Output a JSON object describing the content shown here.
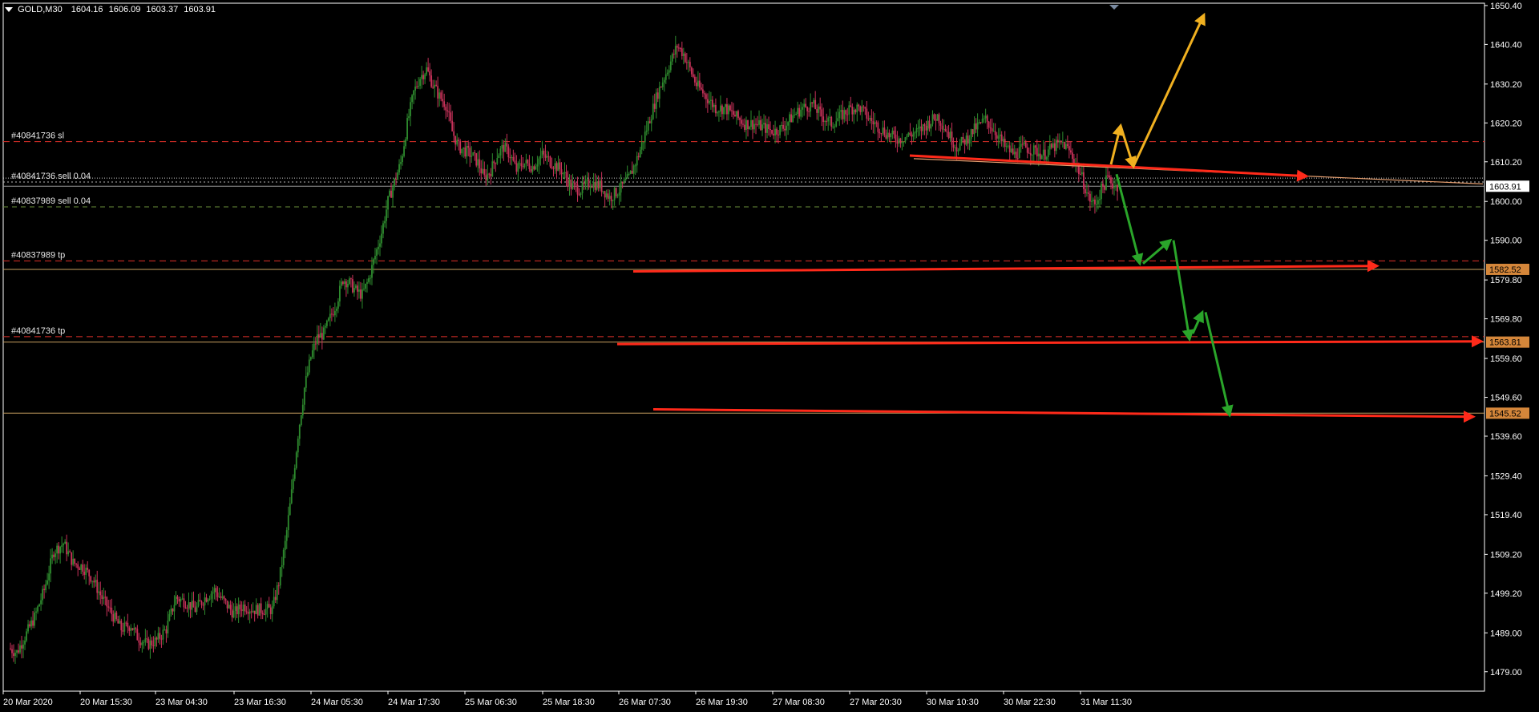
{
  "header": {
    "symbol": "GOLD,M30",
    "open": "1604.16",
    "high": "1606.09",
    "low": "1603.37",
    "close": "1603.91"
  },
  "colors": {
    "background": "#000000",
    "bull": "#2e8b2e",
    "bear": "#c8325a",
    "axis": "#ffffff",
    "sl_line": "#e0302a",
    "sell_line": "#6a8f3a",
    "tp_line": "#e0302a",
    "level_line": "#c8a060",
    "arrow_red": "#ff2a1a",
    "arrow_green": "#2aa52a",
    "arrow_yellow": "#f0b020",
    "bid_label": "#ffffff",
    "level_label": "#d4863a"
  },
  "chart_data": {
    "type": "candlestick",
    "symbol": "GOLD",
    "timeframe": "M30",
    "ylim": [
      1474.0,
      1651.0
    ],
    "y_ticks": [
      "1650.40",
      "1640.40",
      "1630.20",
      "1620.20",
      "1610.20",
      "1600.00",
      "1590.00",
      "1579.80",
      "1569.80",
      "1559.60",
      "1549.60",
      "1539.60",
      "1529.40",
      "1519.40",
      "1509.20",
      "1499.20",
      "1489.00",
      "1479.00"
    ],
    "x_labels": [
      "20 Mar 2020",
      "20 Mar 15:30",
      "23 Mar 04:30",
      "23 Mar 16:30",
      "24 Mar 05:30",
      "24 Mar 17:30",
      "25 Mar 06:30",
      "25 Mar 18:30",
      "26 Mar 07:30",
      "26 Mar 19:30",
      "27 Mar 08:30",
      "27 Mar 20:30",
      "30 Mar 10:30",
      "30 Mar 22:30",
      "31 Mar 11:30"
    ],
    "price_anchors": [
      [
        0,
        1485
      ],
      [
        5,
        1484
      ],
      [
        10,
        1488
      ],
      [
        16,
        1493
      ],
      [
        22,
        1500
      ],
      [
        28,
        1510
      ],
      [
        34,
        1512
      ],
      [
        40,
        1507
      ],
      [
        46,
        1506
      ],
      [
        52,
        1503
      ],
      [
        58,
        1498
      ],
      [
        64,
        1494
      ],
      [
        70,
        1490
      ],
      [
        76,
        1491
      ],
      [
        80,
        1488
      ],
      [
        86,
        1486
      ],
      [
        92,
        1487
      ],
      [
        98,
        1490
      ],
      [
        104,
        1498
      ],
      [
        110,
        1497
      ],
      [
        116,
        1495
      ],
      [
        122,
        1498
      ],
      [
        128,
        1500
      ],
      [
        134,
        1497
      ],
      [
        140,
        1494
      ],
      [
        146,
        1496
      ],
      [
        152,
        1495
      ],
      [
        158,
        1495
      ],
      [
        164,
        1495
      ],
      [
        168,
        1502
      ],
      [
        172,
        1512
      ],
      [
        176,
        1525
      ],
      [
        180,
        1540
      ],
      [
        184,
        1552
      ],
      [
        188,
        1560
      ],
      [
        192,
        1565
      ],
      [
        196,
        1566
      ],
      [
        200,
        1570
      ],
      [
        204,
        1574
      ],
      [
        208,
        1580
      ],
      [
        212,
        1579
      ],
      [
        216,
        1577
      ],
      [
        220,
        1576
      ],
      [
        224,
        1580
      ],
      [
        228,
        1586
      ],
      [
        232,
        1592
      ],
      [
        236,
        1600
      ],
      [
        240,
        1605
      ],
      [
        244,
        1610
      ],
      [
        248,
        1620
      ],
      [
        252,
        1628
      ],
      [
        256,
        1632
      ],
      [
        260,
        1634
      ],
      [
        264,
        1630
      ],
      [
        268,
        1627
      ],
      [
        272,
        1625
      ],
      [
        276,
        1618
      ],
      [
        280,
        1614
      ],
      [
        284,
        1613
      ],
      [
        288,
        1612
      ],
      [
        292,
        1610
      ],
      [
        296,
        1606
      ],
      [
        300,
        1608
      ],
      [
        304,
        1612
      ],
      [
        308,
        1614
      ],
      [
        312,
        1612
      ],
      [
        316,
        1608
      ],
      [
        320,
        1610
      ],
      [
        326,
        1609
      ],
      [
        332,
        1612
      ],
      [
        338,
        1610
      ],
      [
        344,
        1608
      ],
      [
        350,
        1604
      ],
      [
        356,
        1603
      ],
      [
        362,
        1605
      ],
      [
        368,
        1604
      ],
      [
        374,
        1601
      ],
      [
        380,
        1603
      ],
      [
        386,
        1606
      ],
      [
        392,
        1612
      ],
      [
        398,
        1620
      ],
      [
        404,
        1628
      ],
      [
        410,
        1634
      ],
      [
        416,
        1640
      ],
      [
        420,
        1638
      ],
      [
        424,
        1634
      ],
      [
        428,
        1630
      ],
      [
        432,
        1628
      ],
      [
        436,
        1626
      ],
      [
        440,
        1624
      ],
      [
        446,
        1624
      ],
      [
        452,
        1622
      ],
      [
        458,
        1620
      ],
      [
        464,
        1620
      ],
      [
        470,
        1619
      ],
      [
        476,
        1618
      ],
      [
        482,
        1619
      ],
      [
        488,
        1622
      ],
      [
        494,
        1624
      ],
      [
        500,
        1625
      ],
      [
        506,
        1622
      ],
      [
        512,
        1620
      ],
      [
        518,
        1622
      ],
      [
        524,
        1624
      ],
      [
        530,
        1624
      ],
      [
        536,
        1621
      ],
      [
        542,
        1619
      ],
      [
        548,
        1617
      ],
      [
        554,
        1616
      ],
      [
        560,
        1617
      ],
      [
        566,
        1618
      ],
      [
        572,
        1620
      ],
      [
        578,
        1622
      ],
      [
        584,
        1618
      ],
      [
        590,
        1614
      ],
      [
        596,
        1616
      ],
      [
        602,
        1619
      ],
      [
        608,
        1621
      ],
      [
        614,
        1618
      ],
      [
        620,
        1614
      ],
      [
        626,
        1612
      ],
      [
        632,
        1614
      ],
      [
        638,
        1613
      ],
      [
        644,
        1612
      ],
      [
        650,
        1614
      ],
      [
        656,
        1615
      ],
      [
        660,
        1613
      ],
      [
        664,
        1610
      ],
      [
        668,
        1606
      ],
      [
        672,
        1601
      ],
      [
        676,
        1599
      ],
      [
        680,
        1603
      ],
      [
        684,
        1606
      ],
      [
        688,
        1604
      ]
    ],
    "bid": 1603.91,
    "trade_lines": [
      {
        "label": "#40841736 sl",
        "price": 1615.4,
        "style": "dashed-red"
      },
      {
        "label": "#40841736 sell 0.04",
        "price": 1605.0,
        "style": "dotted-white"
      },
      {
        "label": "#40837989 sell 0.04",
        "price": 1598.6,
        "style": "dashed-green"
      },
      {
        "label": "#40837989 tp",
        "price": 1584.7,
        "style": "dashed-red"
      },
      {
        "label": "#40841736 tp",
        "price": 1565.2,
        "style": "dashed-red"
      }
    ],
    "levels": [
      {
        "label": "1582.52",
        "price": 1582.52
      },
      {
        "label": "1563.81",
        "price": 1563.81
      },
      {
        "label": "1545.52",
        "price": 1545.52
      }
    ]
  },
  "price_axis_labels": {
    "bid": "1603.91",
    "level1": "1582.52",
    "level2": "1563.81",
    "level3": "1545.52"
  }
}
